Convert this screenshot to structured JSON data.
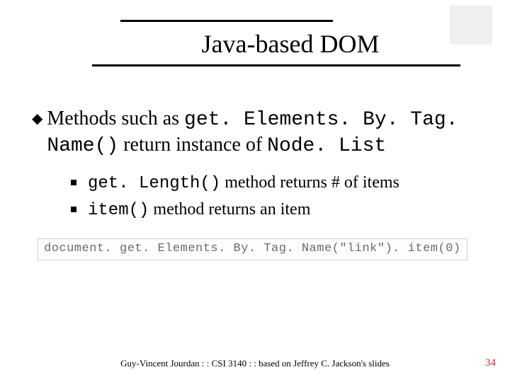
{
  "title": "Java-based DOM",
  "main_bullet": {
    "pre": "Methods such as ",
    "code1": "get. Elements. By. Tag. Name()",
    "mid": " return instance of ",
    "code2": "Node. List"
  },
  "sub_bullets": [
    {
      "code": "get. Length()",
      "text": " method returns # of items"
    },
    {
      "code": "item()",
      "text": " method returns an item"
    }
  ],
  "code_sample": "document. get. Elements. By. Tag. Name(\"link\"). item(0)",
  "footer": "Guy-Vincent Jourdan : : CSI 3140 : : based on Jeffrey C. Jackson's slides",
  "page_number": "34"
}
